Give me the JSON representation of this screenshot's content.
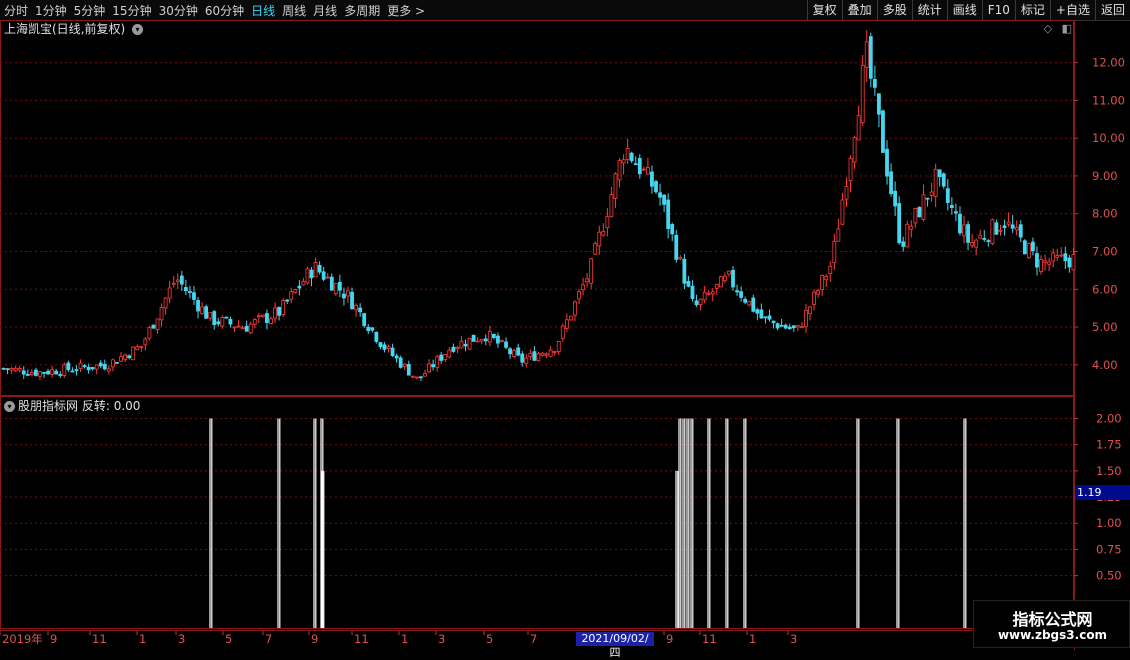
{
  "toolbar": {
    "periods": [
      "分时",
      "1分钟",
      "5分钟",
      "15分钟",
      "30分钟",
      "60分钟",
      "日线",
      "周线",
      "月线",
      "多周期",
      "更多"
    ],
    "active_period": "日线",
    "more_arrow": ">",
    "tools": [
      "复权",
      "叠加",
      "多股",
      "统计",
      "画线",
      "F10",
      "标记",
      "+自选",
      "返回"
    ]
  },
  "main_panel": {
    "title": "上海凯宝(日线,前复权)",
    "dropdown_icon": "chevron-down-icon",
    "y_ticks": [
      "12.00",
      "11.00",
      "10.00",
      "9.00",
      "8.00",
      "7.00",
      "6.00",
      "5.00",
      "4.00"
    ]
  },
  "sub_panel": {
    "title": "股朋指标网",
    "indicator": "反转: 0.00",
    "y_ticks": [
      "2.00",
      "1.75",
      "1.50",
      "1.25",
      "1.00",
      "0.75",
      "0.50"
    ],
    "cursor_value": "1.19"
  },
  "date_axis": {
    "labels": [
      "2019年",
      "9",
      "11",
      "1",
      "3",
      "5",
      "7",
      "9",
      "11",
      "1",
      "3",
      "5",
      "7",
      "9",
      "11",
      "1",
      "3"
    ],
    "cursor_date": "2021/09/02/四"
  },
  "watermark": {
    "line1": "指标公式网",
    "line2": "www.zbgs3.com"
  },
  "colors": {
    "up": "#ff3c3c",
    "down": "#46d7f0",
    "grid": "#6e1010",
    "axis_text": "#e05050",
    "active_period": "#3fd7f5"
  },
  "chart_data": [
    {
      "type": "candlestick",
      "title": "上海凯宝(日线,前复权)",
      "x": [
        "2019-06",
        "2019-08",
        "2019-10",
        "2019-12",
        "2020-01",
        "2020-03",
        "2020-04",
        "2020-06",
        "2020-08",
        "2020-09",
        "2020-10",
        "2020-12",
        "2021-02",
        "2021-04",
        "2021-06",
        "2021-08",
        "2021-09",
        "2021-10",
        "2021-11",
        "2021-12",
        "2022-02",
        "2022-04",
        "2022-06",
        "2022-08",
        "2022-10",
        "2022-11",
        "2023-01",
        "2023-02",
        "2023-03",
        "2023-04",
        "2023-05",
        "2023-07"
      ],
      "close": [
        3.9,
        3.8,
        3.9,
        4.0,
        4.5,
        6.3,
        5.2,
        5.0,
        5.4,
        6.6,
        5.8,
        4.5,
        3.6,
        4.5,
        4.8,
        4.1,
        4.5,
        6.5,
        9.8,
        8.5,
        5.5,
        6.3,
        5.2,
        4.9,
        6.7,
        12.2,
        7.2,
        8.9,
        7.2,
        7.8,
        6.7,
        6.8
      ],
      "ylim": [
        3.2,
        12.6
      ]
    },
    {
      "type": "bar",
      "title": "反转",
      "x": [
        "2020-03",
        "2020-07",
        "2020-09",
        "2020-09",
        "2020-09",
        "2021-10",
        "2021-10",
        "2021-10",
        "2021-10",
        "2021-11",
        "2021-12",
        "2021-12",
        "2022-01",
        "2022-08",
        "2022-10",
        "2023-01"
      ],
      "values": [
        2,
        2,
        2,
        2,
        1.5,
        1.5,
        2,
        2,
        2,
        2,
        2,
        2,
        2,
        2,
        2,
        2
      ],
      "ylim": [
        0,
        2.1
      ]
    }
  ]
}
